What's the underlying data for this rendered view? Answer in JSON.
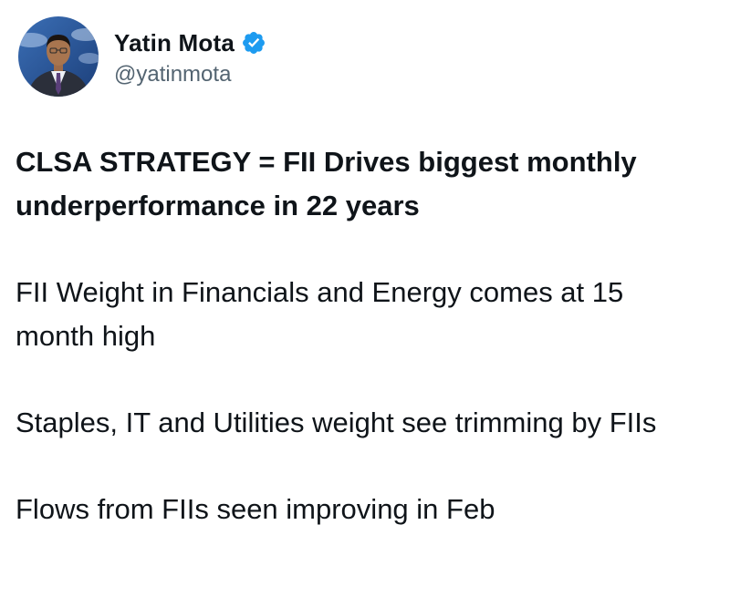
{
  "author": {
    "display_name": "Yatin Mota",
    "handle": "@yatinmota",
    "verified": true,
    "verified_color": "#1d9bf0"
  },
  "watermark": "",
  "tweet": {
    "headline": "CLSA STRATEGY = FII Drives biggest monthly underperformance in 22 years",
    "paragraphs": [
      "FII Weight in Financials and Energy comes at 15 month high",
      "Staples, IT and Utilities weight see trimming by FIIs",
      "Flows from FIIs seen improving in Feb"
    ]
  },
  "colors": {
    "text": "#0f1419",
    "secondary": "#536471"
  }
}
